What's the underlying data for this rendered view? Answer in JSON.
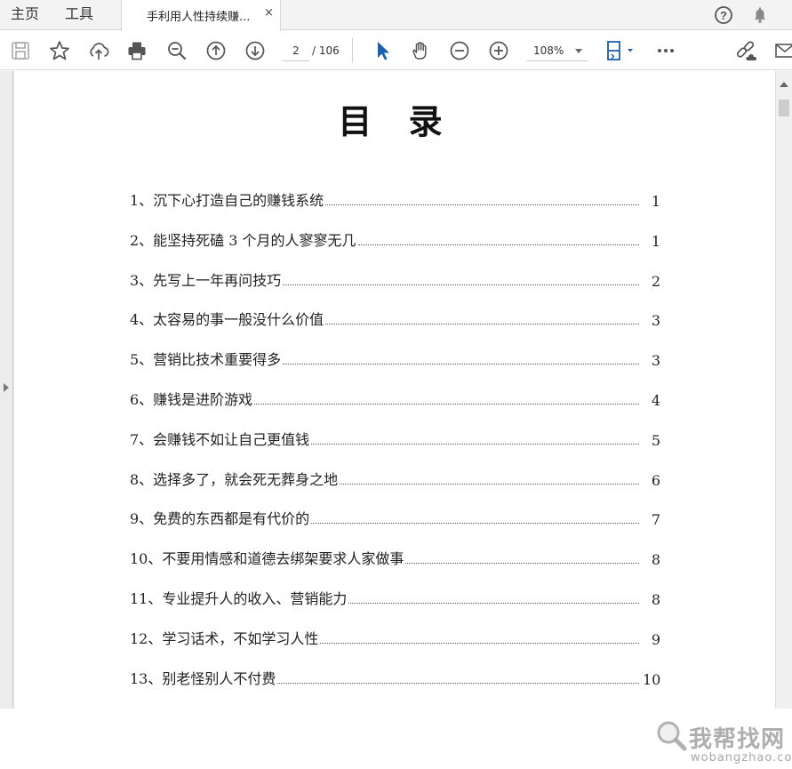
{
  "tabbar": {
    "home_label": "主页",
    "tools_label": "工具",
    "doc_tab_label": "手利用人性持续赚...",
    "doc_tab_close": "×"
  },
  "toolbar": {
    "current_page": "2",
    "total_pages": "/ 106",
    "zoom": "108%"
  },
  "document": {
    "title": "目 录",
    "toc": [
      {
        "text": "1、沉下心打造自己的赚钱系统",
        "page": "1"
      },
      {
        "text": "2、能坚持死磕 3 个月的人寥寥无几",
        "page": "1"
      },
      {
        "text": "3、先写上一年再问技巧",
        "page": "2"
      },
      {
        "text": "4、太容易的事一般没什么价值",
        "page": "3"
      },
      {
        "text": "5、营销比技术重要得多",
        "page": "3"
      },
      {
        "text": "6、赚钱是进阶游戏",
        "page": "4"
      },
      {
        "text": "7、会赚钱不如让自己更值钱",
        "page": "5"
      },
      {
        "text": "8、选择多了，就会死无葬身之地",
        "page": "6"
      },
      {
        "text": "9、免费的东西都是有代价的",
        "page": "7"
      },
      {
        "text": "10、不要用情感和道德去绑架要求人家做事",
        "page": "8"
      },
      {
        "text": "11、专业提升人的收入、营销能力",
        "page": "8"
      },
      {
        "text": "12、学习话术，不如学习人性",
        "page": "9"
      },
      {
        "text": "13、别老怪别人不付费",
        "page": "10"
      }
    ]
  },
  "watermark": {
    "cn": "我帮找网",
    "en": "wobangzhao.com"
  },
  "icons": [
    "save-icon",
    "star-icon",
    "upload-cloud-icon",
    "print-icon",
    "zoom-out-magnifier-icon",
    "page-up-icon",
    "page-down-icon",
    "select-cursor-icon",
    "hand-tool-icon",
    "zoom-minus-icon",
    "zoom-plus-icon",
    "fit-page-icon",
    "more-icon",
    "link-icon",
    "mail-icon",
    "help-icon",
    "bell-icon"
  ],
  "colors": {
    "accent": "#1a5fb4",
    "toolbar_icon": "#555555"
  }
}
